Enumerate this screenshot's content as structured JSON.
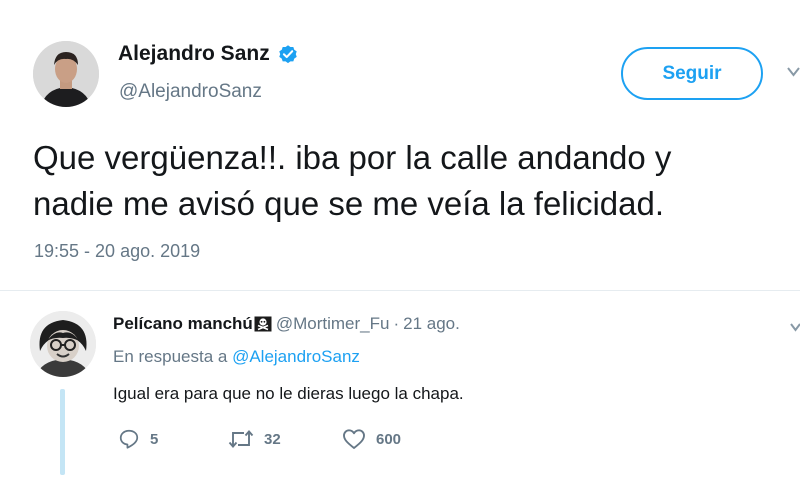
{
  "tweet": {
    "author_name": "Alejandro Sanz",
    "author_handle": "@AlejandroSanz",
    "follow_label": "Seguir",
    "text_line1": "Que vergüenza!!. iba por la calle andando y",
    "text_line2": "nadie me avisó que se me veía la felicidad.",
    "timestamp": "19:55 - 20 ago. 2019",
    "verified_icon": "verified-badge-icon"
  },
  "reply": {
    "author_name": "Pelícano manchú",
    "author_emoji": "skull-crossbones-flag-icon",
    "author_handle": "@Mortimer_Fu",
    "separator": "·",
    "date": "21 ago.",
    "reply_to_prefix": "En respuesta a ",
    "reply_to_handle": "@AlejandroSanz",
    "text": "Igual era para que no le dieras luego la chapa.",
    "replies_count": "5",
    "retweets_count": "32",
    "likes_count": "600"
  },
  "colors": {
    "accent": "#1da1f2",
    "muted": "#657786",
    "text": "#14171a",
    "thread_line": "#c4e5f5"
  }
}
